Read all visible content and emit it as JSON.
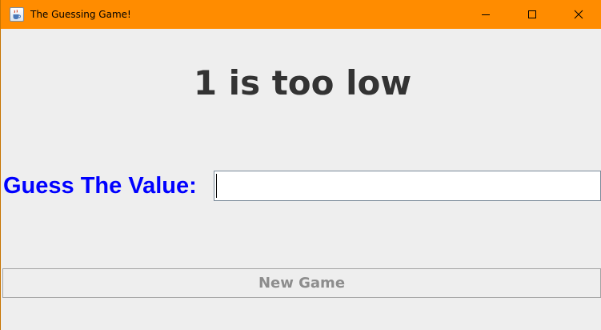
{
  "window": {
    "title": "The Guessing Game!",
    "titlebar_color": "#ff8c00",
    "icon": "java-coffee-cup-icon",
    "controls": [
      "minimize-icon",
      "maximize-icon",
      "close-icon"
    ]
  },
  "main": {
    "status_message": "1 is too low",
    "guess_label": "Guess The Value:",
    "guess_input_value": "",
    "new_game_label": "New Game",
    "new_game_enabled": false,
    "label_color": "#0000ff",
    "status_color": "#333333"
  }
}
